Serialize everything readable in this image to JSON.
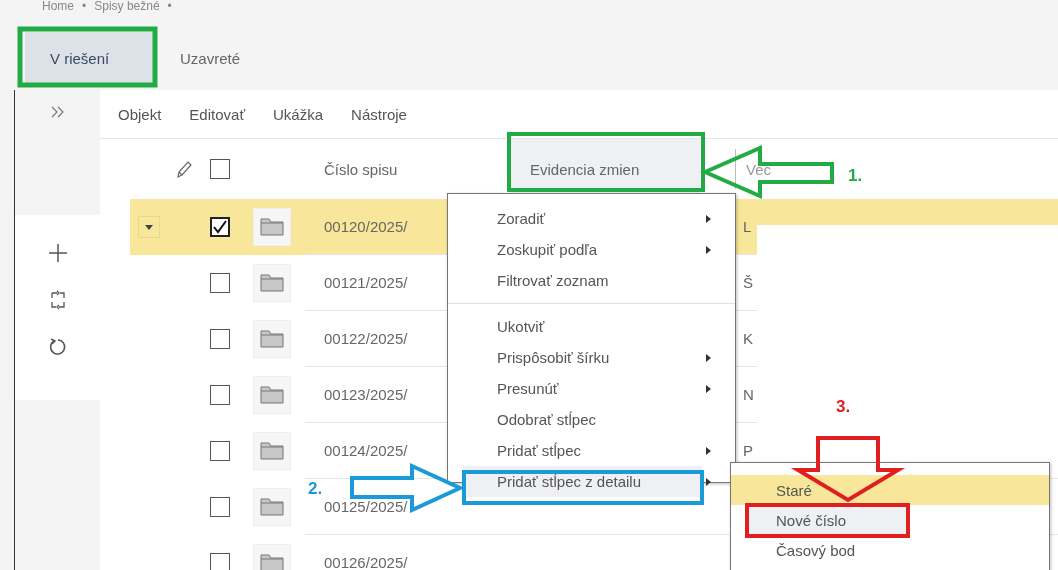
{
  "breadcrumb": {
    "items": [
      "Home",
      "Spisy bežné"
    ],
    "separator": "•"
  },
  "tabs": [
    {
      "label": "V riešení",
      "selected": true
    },
    {
      "label": "Uzavreté",
      "selected": false
    }
  ],
  "toolbar": [
    "Objekt",
    "Editovať",
    "Ukážka",
    "Nástroje"
  ],
  "table": {
    "header_checked": false,
    "columns": [
      {
        "label": "Číslo spisu",
        "highlighted": false
      },
      {
        "label": "Evidencia zmien",
        "highlighted": true
      },
      {
        "label": "Vec",
        "highlighted": false
      }
    ],
    "rows": [
      {
        "number": "00120/2025/",
        "vec": "L",
        "checked": true,
        "selected": true
      },
      {
        "number": "00121/2025/",
        "vec": "Š",
        "checked": false,
        "selected": false
      },
      {
        "number": "00122/2025/",
        "vec": "K",
        "checked": false,
        "selected": false
      },
      {
        "number": "00123/2025/",
        "vec": "N",
        "checked": false,
        "selected": false
      },
      {
        "number": "00124/2025/",
        "vec": "P",
        "checked": false,
        "selected": false
      },
      {
        "number": "00125/2025/",
        "checked": false,
        "selected": false
      },
      {
        "number": "00126/2025/",
        "checked": false,
        "selected": false
      }
    ]
  },
  "context_menu": {
    "items": [
      {
        "kind": "item",
        "label": "Zoradiť",
        "submenu": true,
        "highlighted": false
      },
      {
        "kind": "item",
        "label": "Zoskupiť podľa",
        "submenu": true,
        "highlighted": false
      },
      {
        "kind": "item",
        "label": "Filtrovať zoznam",
        "submenu": false,
        "highlighted": false
      },
      {
        "kind": "separator"
      },
      {
        "kind": "item",
        "label": "Ukotviť",
        "submenu": false,
        "highlighted": false
      },
      {
        "kind": "item",
        "label": "Prispôsobiť šírku",
        "submenu": true,
        "highlighted": false
      },
      {
        "kind": "item",
        "label": "Presunúť",
        "submenu": true,
        "highlighted": false
      },
      {
        "kind": "item",
        "label": "Odobrať stĺpec",
        "submenu": false,
        "highlighted": false
      },
      {
        "kind": "item",
        "label": "Pridať stĺpec",
        "submenu": true,
        "highlighted": false
      },
      {
        "kind": "item",
        "label": "Pridať stĺpec z detailu",
        "submenu": true,
        "highlighted": true
      }
    ]
  },
  "submenu": {
    "items": [
      {
        "label": "Staré",
        "selected": true,
        "highlighted": false
      },
      {
        "label": "Nové číslo",
        "selected": false,
        "highlighted": true
      },
      {
        "label": "Časový bod",
        "selected": false,
        "highlighted": false
      }
    ]
  },
  "annotations": [
    {
      "label": "1.",
      "color": "#22aa44"
    },
    {
      "label": "2.",
      "color": "#1a9ad6"
    },
    {
      "label": "3.",
      "color": "#e02020"
    }
  ]
}
